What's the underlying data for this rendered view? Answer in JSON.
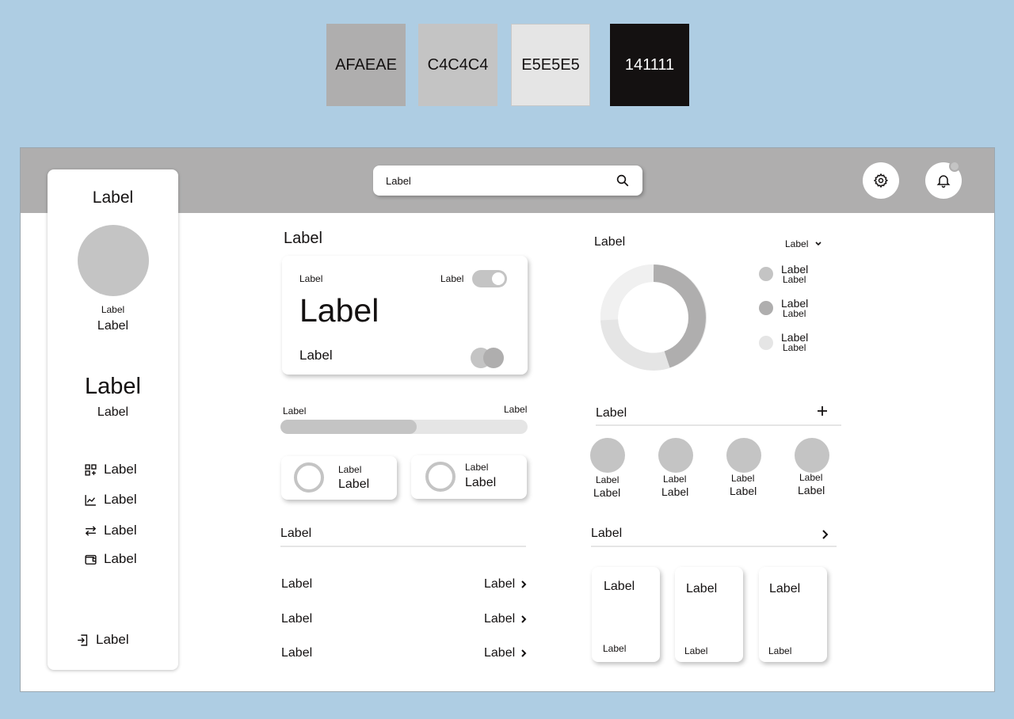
{
  "swatches": [
    {
      "hex": "AFAEAE",
      "color": "#afaeae",
      "text_color": "#141111"
    },
    {
      "hex": "C4C4C4",
      "color": "#c4c4c4",
      "text_color": "#141111"
    },
    {
      "hex": "E5E5E5",
      "color": "#e5e5e5",
      "text_color": "#141111"
    },
    {
      "hex": "141111",
      "color": "#141111",
      "text_color": "#ffffff"
    }
  ],
  "header": {
    "search_label": "Label"
  },
  "sidebar": {
    "title": "Label",
    "profile_caption": "Label",
    "profile_name": "Label",
    "stat_value": "Label",
    "stat_caption": "Label",
    "nav": [
      {
        "icon": "grid-add-icon",
        "label": "Label"
      },
      {
        "icon": "chart-line-icon",
        "label": "Label"
      },
      {
        "icon": "transfer-icon",
        "label": "Label"
      },
      {
        "icon": "wallet-icon",
        "label": "Label"
      }
    ],
    "logout_label": "Label"
  },
  "balance": {
    "section_title": "Label",
    "top_left": "Label",
    "toggle_label": "Label",
    "amount": "Label",
    "footer": "Label"
  },
  "progress": {
    "left_label": "Label",
    "right_label": "Label",
    "fraction": 0.55
  },
  "mini_cards": [
    {
      "caption": "Label",
      "value": "Label"
    },
    {
      "caption": "Label",
      "value": "Label"
    }
  ],
  "list": {
    "title": "Label",
    "rows": [
      {
        "left": "Label",
        "right": "Label"
      },
      {
        "left": "Label",
        "right": "Label"
      },
      {
        "left": "Label",
        "right": "Label"
      }
    ]
  },
  "donut": {
    "title": "Label",
    "dropdown": "Label",
    "legend": [
      {
        "top": "Label",
        "bottom": "Label",
        "color": "#c4c4c4"
      },
      {
        "top": "Label",
        "bottom": "Label",
        "color": "#afaeae"
      },
      {
        "top": "Label",
        "bottom": "Label",
        "color": "#e5e5e5"
      }
    ]
  },
  "contacts": {
    "title": "Label",
    "people": [
      {
        "top": "Label",
        "bottom": "Label"
      },
      {
        "top": "Label",
        "bottom": "Label"
      },
      {
        "top": "Label",
        "bottom": "Label"
      },
      {
        "top": "Label",
        "bottom": "Label"
      }
    ]
  },
  "gallery": {
    "title": "Label",
    "cards": [
      {
        "title": "Label",
        "caption": "Label"
      },
      {
        "title": "Label",
        "caption": "Label"
      },
      {
        "title": "Label",
        "caption": "Label"
      }
    ]
  }
}
